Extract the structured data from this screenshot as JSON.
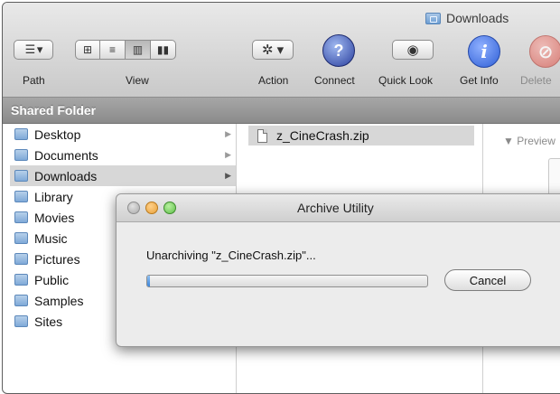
{
  "window": {
    "title": "Downloads"
  },
  "toolbar": {
    "path_label": "Path",
    "view_label": "View",
    "action_label": "Action",
    "connect_label": "Connect",
    "quicklook_label": "Quick Look",
    "getinfo_label": "Get Info",
    "delete_label": "Delete",
    "icons": {
      "path": "path-menu-icon",
      "view_icons": "icon-grid-icon",
      "view_list": "list-view-icon",
      "view_columns": "column-view-icon",
      "view_coverflow": "cover-flow-icon",
      "action": "gear-icon",
      "connect": "connect-globe-icon",
      "quicklook": "eye-icon",
      "getinfo": "info-icon",
      "delete": "no-entry-icon"
    }
  },
  "sidebar": {
    "header": "Shared Folder"
  },
  "column1": {
    "items": [
      {
        "label": "Desktop",
        "arrow": "▶"
      },
      {
        "label": "Documents",
        "arrow": "▶"
      },
      {
        "label": "Downloads",
        "arrow": "▶"
      },
      {
        "label": "Library",
        "arrow": ""
      },
      {
        "label": "Movies",
        "arrow": ""
      },
      {
        "label": "Music",
        "arrow": ""
      },
      {
        "label": "Pictures",
        "arrow": ""
      },
      {
        "label": "Public",
        "arrow": ""
      },
      {
        "label": "Samples",
        "arrow": ""
      },
      {
        "label": "Sites",
        "arrow": ""
      }
    ]
  },
  "column2": {
    "file": "z_CineCrash.zip"
  },
  "preview": {
    "label": "▼ Preview"
  },
  "dialog": {
    "title": "Archive Utility",
    "message": "Unarchiving \"z_CineCrash.zip\"...",
    "progress_percent": 1,
    "cancel_label": "Cancel"
  },
  "colors": {
    "accent": "#3c85d9",
    "close": "#e0443e",
    "minimize": "#e8a23a",
    "zoom": "#5fbf4a",
    "info_blue": "#3d6fe0"
  }
}
